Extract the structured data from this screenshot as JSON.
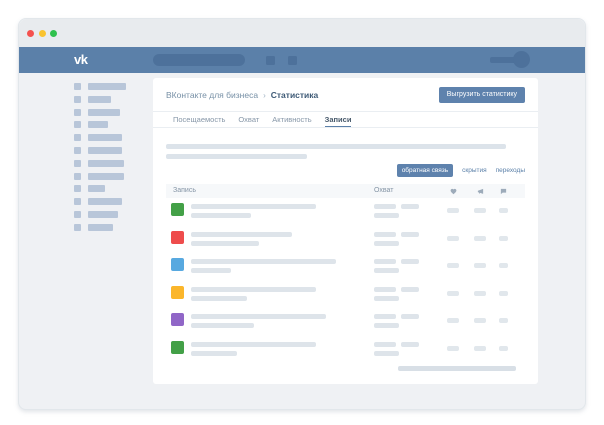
{
  "browser": {
    "traffic_lights": [
      "#f4514e",
      "#f9c32f",
      "#2fc14e"
    ]
  },
  "vk_header": {
    "logo_text": "vk",
    "bg_color": "#5b80a9",
    "placeholder_color": "#4d719b"
  },
  "sidebar": {
    "item_color": "#b8c6d9",
    "item_widths": [
      38,
      23,
      32,
      20,
      34,
      34,
      36,
      36,
      17,
      34,
      30,
      25
    ]
  },
  "card": {
    "breadcrumb": {
      "parent": "ВКонтакте для бизнеса",
      "separator": "›",
      "current": "Статистика"
    },
    "export_button_label": "Выгрузить статистику",
    "accent_color": "#5e82ad",
    "tabs": [
      {
        "label": "Посещаемость",
        "active": false
      },
      {
        "label": "Охват",
        "active": false
      },
      {
        "label": "Активность",
        "active": false
      },
      {
        "label": "Записи",
        "active": true
      }
    ],
    "filters": [
      {
        "label": "обратная связь",
        "active": true
      },
      {
        "label": "скрытия",
        "active": false
      },
      {
        "label": "переходы",
        "active": false
      }
    ],
    "table": {
      "record_column_label": "Запись",
      "reach_column_label": "Охват",
      "icon_columns": [
        "heart-icon",
        "megaphone-icon",
        "comment-icon"
      ],
      "rows": [
        {
          "color": "#43a047",
          "title_w": 125,
          "subtitle_w": 60
        },
        {
          "color": "#ee4c4c",
          "title_w": 101,
          "subtitle_w": 68
        },
        {
          "color": "#58a9e0",
          "title_w": 145,
          "subtitle_w": 40
        },
        {
          "color": "#fbb62b",
          "title_w": 125,
          "subtitle_w": 56
        },
        {
          "color": "#9066c7",
          "title_w": 135,
          "subtitle_w": 63
        },
        {
          "color": "#43a047",
          "title_w": 125,
          "subtitle_w": 46
        }
      ]
    }
  }
}
